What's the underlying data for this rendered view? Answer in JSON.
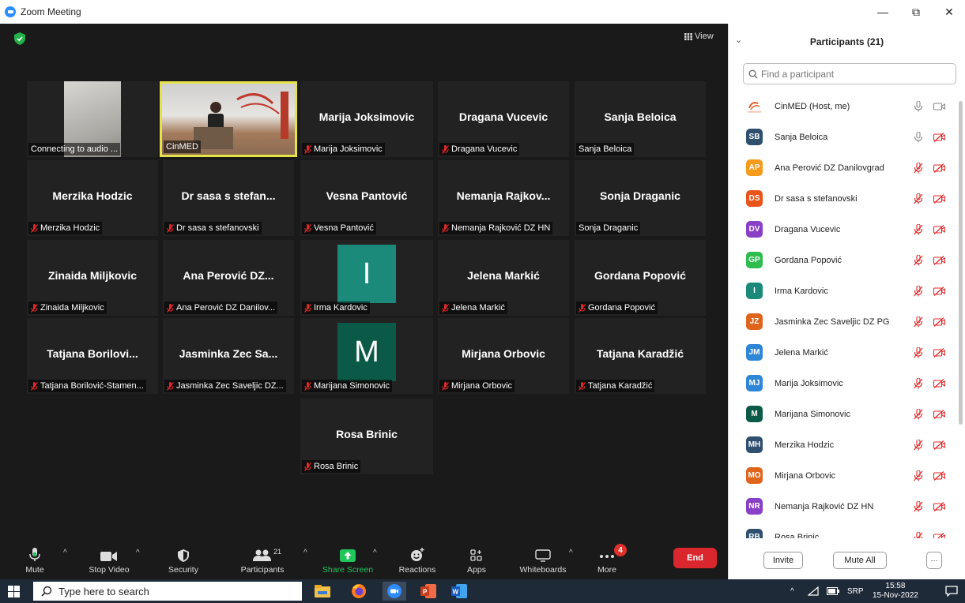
{
  "window": {
    "title": "Zoom Meeting",
    "minimize": "—",
    "maximize": "⧉",
    "close": "✕"
  },
  "meeting": {
    "view_label": "View"
  },
  "tiles": [
    {
      "big": "",
      "label": "Connecting to audio ...",
      "muted": false,
      "video": "connecting"
    },
    {
      "big": "",
      "label": "CinMED",
      "muted": false,
      "video": "speaker"
    },
    {
      "big": "Marija Joksimovic",
      "label": "Marija Joksimovic",
      "muted": true
    },
    {
      "big": "Dragana Vucevic",
      "label": "Dragana Vucevic",
      "muted": true
    },
    {
      "big": "Sanja Beloica",
      "label": "Sanja Beloica",
      "muted": false
    },
    {
      "big": "Merzika Hodzic",
      "label": "Merzika Hodzic",
      "muted": true
    },
    {
      "big": "Dr sasa s stefan...",
      "label": "Dr sasa s stefanovski",
      "muted": true
    },
    {
      "big": "Vesna Pantović",
      "label": "Vesna Pantović",
      "muted": true
    },
    {
      "big": "Nemanja Rajkov...",
      "label": "Nemanja Rajković DZ HN",
      "muted": true
    },
    {
      "big": "Sonja Draganic",
      "label": "Sonja Draganic",
      "muted": false
    },
    {
      "big": "Zinaida Miljkovic",
      "label": "Zinaida Miljkovic",
      "muted": true
    },
    {
      "big": "Ana Perović DZ...",
      "label": "Ana Perović DZ Danilov...",
      "muted": true
    },
    {
      "big": "",
      "label": "Irma Kardovic",
      "muted": true,
      "avatar": "I",
      "avatar_color": "#1b8a7a"
    },
    {
      "big": "Jelena Markić",
      "label": "Jelena Markić",
      "muted": true
    },
    {
      "big": "Gordana Popović",
      "label": "Gordana Popović",
      "muted": true
    },
    {
      "big": "Tatjana Borilovi...",
      "label": "Tatjana Borilović-Stamen...",
      "muted": true
    },
    {
      "big": "Jasminka Zec Sa...",
      "label": "Jasminka Zec Saveljic DZ...",
      "muted": true
    },
    {
      "big": "",
      "label": "Marijana Simonovic",
      "muted": true,
      "avatar": "M",
      "avatar_color": "#0b5a47"
    },
    {
      "big": "Mirjana Orbovic",
      "label": "Mirjana Orbovic",
      "muted": true
    },
    {
      "big": "Tatjana Karadžić",
      "label": "Tatjana Karadžić",
      "muted": true
    },
    {
      "big": "Rosa Brinic",
      "label": "Rosa Brinic",
      "muted": true
    }
  ],
  "toolbar": {
    "mute": "Mute",
    "stop_video": "Stop Video",
    "security": "Security",
    "participants": "Participants",
    "participants_count": "21",
    "share_screen": "Share Screen",
    "reactions": "Reactions",
    "apps": "Apps",
    "whiteboards": "Whiteboards",
    "more": "More",
    "more_badge": "4",
    "end": "End"
  },
  "panel": {
    "title": "Participants (21)",
    "search_placeholder": "Find a participant",
    "invite": "Invite",
    "mute_all": "Mute All",
    "more": "···",
    "participants": [
      {
        "initials": "",
        "name": "CinMED (Host, me)",
        "color": "#ffffff",
        "muted": false,
        "video_off": false,
        "logo": true
      },
      {
        "initials": "SB",
        "name": "Sanja Beloica",
        "color": "#2f4f6f",
        "muted": false,
        "video_off": true
      },
      {
        "initials": "AP",
        "name": "Ana Perović DZ Danilovgrad",
        "color": "#f59a1b",
        "muted": true,
        "video_off": true
      },
      {
        "initials": "DS",
        "name": "Dr sasa s stefanovski",
        "color": "#e8541a",
        "muted": true,
        "video_off": true
      },
      {
        "initials": "DV",
        "name": "Dragana Vucevic",
        "color": "#8a3fc7",
        "muted": true,
        "video_off": true
      },
      {
        "initials": "GP",
        "name": "Gordana Popović",
        "color": "#2ebd4e",
        "muted": true,
        "video_off": true
      },
      {
        "initials": "I",
        "name": "Irma Kardovic",
        "color": "#1b8a7a",
        "muted": true,
        "video_off": true
      },
      {
        "initials": "JZ",
        "name": "Jasminka Zec Saveljic DZ PG",
        "color": "#e0651c",
        "muted": true,
        "video_off": true
      },
      {
        "initials": "JM",
        "name": "Jelena Markić",
        "color": "#2f86d6",
        "muted": true,
        "video_off": true
      },
      {
        "initials": "MJ",
        "name": "Marija Joksimovic",
        "color": "#2f86d6",
        "muted": true,
        "video_off": true
      },
      {
        "initials": "M",
        "name": "Marijana Simonovic",
        "color": "#0b5a47",
        "muted": true,
        "video_off": true
      },
      {
        "initials": "MH",
        "name": "Merzika Hodzic",
        "color": "#2f4f6f",
        "muted": true,
        "video_off": true
      },
      {
        "initials": "MO",
        "name": "Mirjana Orbovic",
        "color": "#e0651c",
        "muted": true,
        "video_off": true
      },
      {
        "initials": "NR",
        "name": "Nemanja Rajković DZ HN",
        "color": "#8a3fc7",
        "muted": true,
        "video_off": true
      },
      {
        "initials": "RB",
        "name": "Rosa Brinic",
        "color": "#2f4f6f",
        "muted": true,
        "video_off": true
      }
    ]
  },
  "taskbar": {
    "search_placeholder": "Type here to search",
    "lang": "SRP",
    "time": "15:58",
    "date": "15-Nov-2022"
  },
  "colors": {
    "muted_red": "#e02828",
    "active_speaker": "#e6e34a",
    "share_green": "#1fc75b",
    "end_red": "#d9272d"
  }
}
